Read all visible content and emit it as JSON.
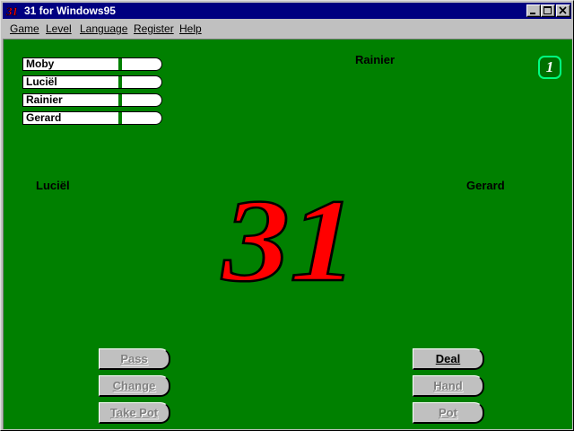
{
  "window": {
    "title": "31 for Windows95",
    "icon": "31-logo-icon",
    "controls": [
      "minimize-icon",
      "maximize-icon",
      "close-icon"
    ]
  },
  "menu": {
    "items": [
      {
        "label": "Game",
        "accel": "G"
      },
      {
        "label": "Level",
        "accel": "L"
      },
      {
        "label": "Language",
        "accel": "L"
      },
      {
        "label": "Register",
        "accel": "R"
      },
      {
        "label": "Help",
        "accel": "H"
      }
    ]
  },
  "scoreboard": {
    "players": [
      "Moby",
      "Luciël",
      "Rainier",
      "Gerard"
    ]
  },
  "seats": {
    "top": "Rainier",
    "left": "Luciël",
    "right": "Gerard"
  },
  "round": "1",
  "logo_text": "31",
  "colors": {
    "table": "#008000",
    "titlebar": "#000080",
    "logo_fill": "#ff0000",
    "logo_stroke": "#000000",
    "badge_border": "#00ff80"
  },
  "buttons": {
    "pass": {
      "label": "Pass",
      "enabled": false
    },
    "change": {
      "label": "Change",
      "enabled": false
    },
    "take_pot": {
      "label": "Take Pot",
      "enabled": false
    },
    "deal": {
      "label": "Deal",
      "enabled": true
    },
    "hand": {
      "label": "Hand",
      "enabled": false
    },
    "pot": {
      "label": "Pot",
      "enabled": false
    }
  }
}
